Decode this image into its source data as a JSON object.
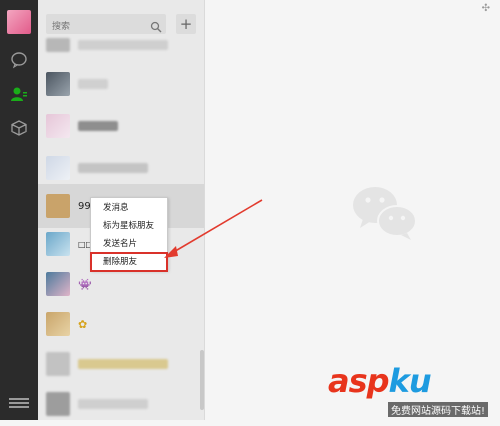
{
  "search": {
    "placeholder": "搜索"
  },
  "toolbar": {
    "add_label": "+"
  },
  "contacts": [
    {
      "name": "99",
      "color": "#c9a36a"
    },
    {
      "name": "□□",
      "color": "#6aa7c9"
    }
  ],
  "context_menu": {
    "items": [
      "发消息",
      "标为星标朋友",
      "发送名片",
      "删除朋友"
    ]
  },
  "watermark": {
    "brand_red": "asp",
    "brand_blue": "ku",
    "subtitle": "免费网站源码下载站!"
  },
  "colors": {
    "rail": "#2b2b2b",
    "list": "#e9e9e9",
    "accent_green": "#1aad19",
    "highlight_red": "#d9312a"
  }
}
